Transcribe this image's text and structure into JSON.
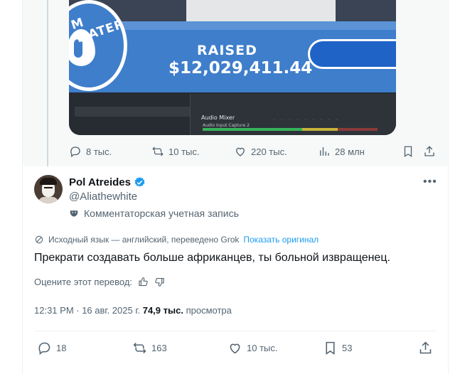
{
  "parent_tweet": {
    "media": {
      "logo_text": "M WATER",
      "raised_label": "RAISED",
      "raised_amount": "$12,029,411.44",
      "mixer_title": "Audio Mixer",
      "mixer_source": "Audio Input Capture 2"
    },
    "actions": {
      "replies": "8 тыс.",
      "reposts": "10 тыс.",
      "likes": "220 тыс.",
      "views": "28 млн"
    }
  },
  "tweet": {
    "display_name": "Pol Atreides",
    "handle": "@Aliathewhite",
    "account_type": "Комментаторская учетная запись",
    "translation_note": "Исходный язык — английский, переведено Grok",
    "show_original_label": "Показать оригинал",
    "text": "Прекрати создавать больше африканцев, ты больной извращенец.",
    "rate_translation_label": "Оцените этот перевод:",
    "timestamp": "12:31 PM · 16 авг. 2025 г.",
    "views_count": "74,9 тыс.",
    "views_label": "просмотра",
    "actions": {
      "replies": "18",
      "reposts": "163",
      "likes": "10 тыс.",
      "bookmarks": "53"
    }
  },
  "icons": [
    "reply-icon",
    "repost-icon",
    "like-icon",
    "views-icon",
    "bookmark-icon",
    "share-icon",
    "verified-badge-icon",
    "more-icon",
    "mask-icon",
    "translate-icon",
    "thumbs-up-icon",
    "thumbs-down-icon"
  ],
  "colors": {
    "accent": "#1d9bf0",
    "muted": "#536471",
    "text": "#0f1419"
  }
}
